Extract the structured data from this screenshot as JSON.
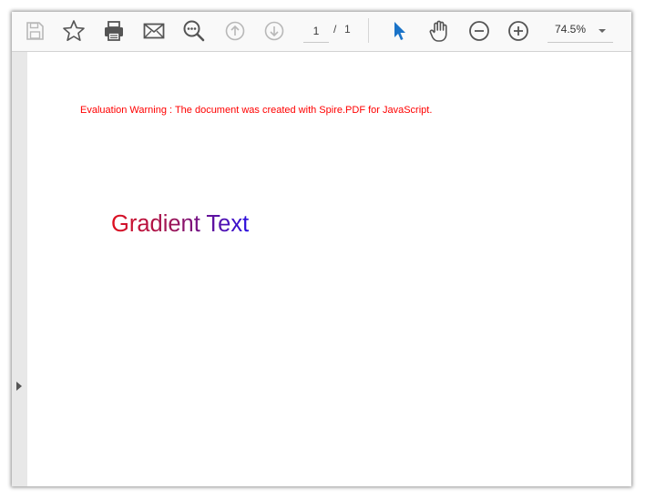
{
  "toolbar": {
    "icons": [
      "save-icon",
      "bookmark-star-icon",
      "print-icon",
      "email-icon",
      "search-icon",
      "previous-page-icon",
      "next-page-icon",
      "select-cursor-icon",
      "hand-pan-icon",
      "zoom-out-icon",
      "zoom-in-icon"
    ],
    "current_page": "1",
    "page_separator": "/",
    "total_pages": "1",
    "zoom_value": "74.5%",
    "accent_color": "#1a73c8"
  },
  "document": {
    "warning_text": "Evaluation Warning : The document was created with Spire.PDF for JavaScript.",
    "warning_color": "#ff0000",
    "body_text": "Gradient Text",
    "gradient_colors": [
      "#e0101e",
      "#2a10e0"
    ]
  }
}
